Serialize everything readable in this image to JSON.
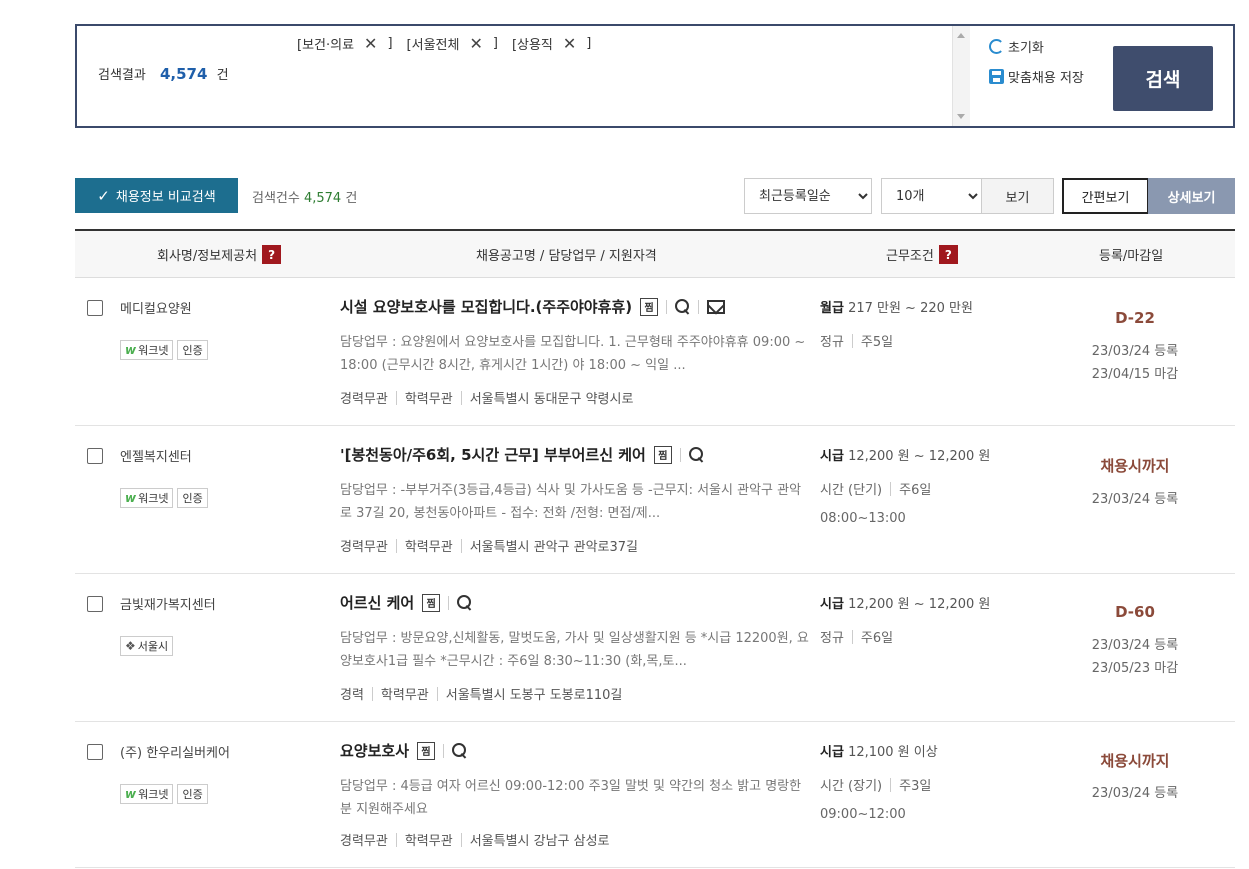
{
  "search_box": {
    "filters": [
      "[보건·의료",
      "[서울전체",
      "[상용직"
    ],
    "filter_close": "]",
    "result_label": "검색결과",
    "result_count": "4,574",
    "result_unit": "건",
    "reset_label": "초기화",
    "save_label": "맞춤채용 저장",
    "search_button": "검색"
  },
  "toolbar": {
    "compare_label": "채용정보 비교검색",
    "count_label": "검색건수",
    "count_value": "4,574",
    "count_unit": "건",
    "sort_selected": "최근등록일순",
    "size_selected": "10개",
    "view_button": "보기",
    "simple_view": "간편보기",
    "detail_view": "상세보기"
  },
  "table_header": {
    "col_company": "회사명/정보제공처",
    "col_title": "채용공고명 / 담당업무 / 지원자격",
    "col_condition": "근무조건",
    "col_date": "등록/마감일",
    "help_symbol": "?"
  },
  "badge_text": {
    "worknet_symbol": "w",
    "worknet": "워크넷",
    "certified": "인증",
    "seoul_symbol": "❖",
    "seoul": "서울시"
  },
  "rows": [
    {
      "company": "메디컬요양원",
      "title": "시설 요양보호사를 모집합니다.(주주야야휴휴)",
      "save_symbol": "찜",
      "desc": "담당업무 : 요양원에서 요양보호사를 모집합니다. 1. 근무형태 주주야야휴휴 09:00 ~ 18:00 (근무시간 8시간, 휴게시간 1시간) 야 18:00 ~ 익일 ...",
      "meta": [
        "경력무관",
        "학력무관",
        "서울특별시 동대문구 약령시로"
      ],
      "pay_type": "월급",
      "pay": "217 만원 ~ 220 만원",
      "employment": [
        "정규",
        "주5일"
      ],
      "hours": "",
      "dday": "D-22",
      "registered": "23/03/24 등록",
      "deadline": "23/04/15 마감"
    },
    {
      "company": "엔젤복지센터",
      "title": "'[봉천동아/주6회, 5시간 근무] 부부어르신 케어",
      "save_symbol": "찜",
      "desc": "담당업무 : -부부거주(3등급,4등급) 식사 및 가사도움 등 -근무지: 서울시 관악구 관악로 37길 20, 봉천동아아파트 - 접수: 전화 /전형: 면접/제...",
      "meta": [
        "경력무관",
        "학력무관",
        "서울특별시 관악구 관악로37길"
      ],
      "pay_type": "시급",
      "pay": "12,200 원 ~ 12,200 원",
      "employment": [
        "시간 (단기)",
        "주6일"
      ],
      "hours": "08:00~13:00",
      "dday": "채용시까지",
      "registered": "23/03/24 등록",
      "deadline": ""
    },
    {
      "company": "금빛재가복지센터",
      "title": "어르신 케어",
      "save_symbol": "찜",
      "desc": "담당업무 : 방문요양,신체활동, 말벗도움, 가사 및 일상생활지원 등 *시급 12200원, 요양보호사1급 필수 *근무시간 : 주6일 8:30~11:30 (화,목,토...",
      "meta": [
        "경력",
        "학력무관",
        "서울특별시 도봉구 도봉로110길"
      ],
      "pay_type": "시급",
      "pay": "12,200 원 ~ 12,200 원",
      "employment": [
        "정규",
        "주6일"
      ],
      "hours": "",
      "dday": "D-60",
      "registered": "23/03/24 등록",
      "deadline": "23/05/23 마감"
    },
    {
      "company": "(주) 한우리실버케어",
      "title": "요양보호사",
      "save_symbol": "찜",
      "desc": "담당업무 : 4등급 여자 어르신 09:00-12:00 주3일 말벗 및 약간의 청소 밝고 명랑한분 지원해주세요",
      "meta": [
        "경력무관",
        "학력무관",
        "서울특별시 강남구 삼성로"
      ],
      "pay_type": "시급",
      "pay": "12,100 원 이상",
      "employment": [
        "시간 (장기)",
        "주3일"
      ],
      "hours": "09:00~12:00",
      "dday": "채용시까지",
      "registered": "23/03/24 등록",
      "deadline": ""
    }
  ]
}
